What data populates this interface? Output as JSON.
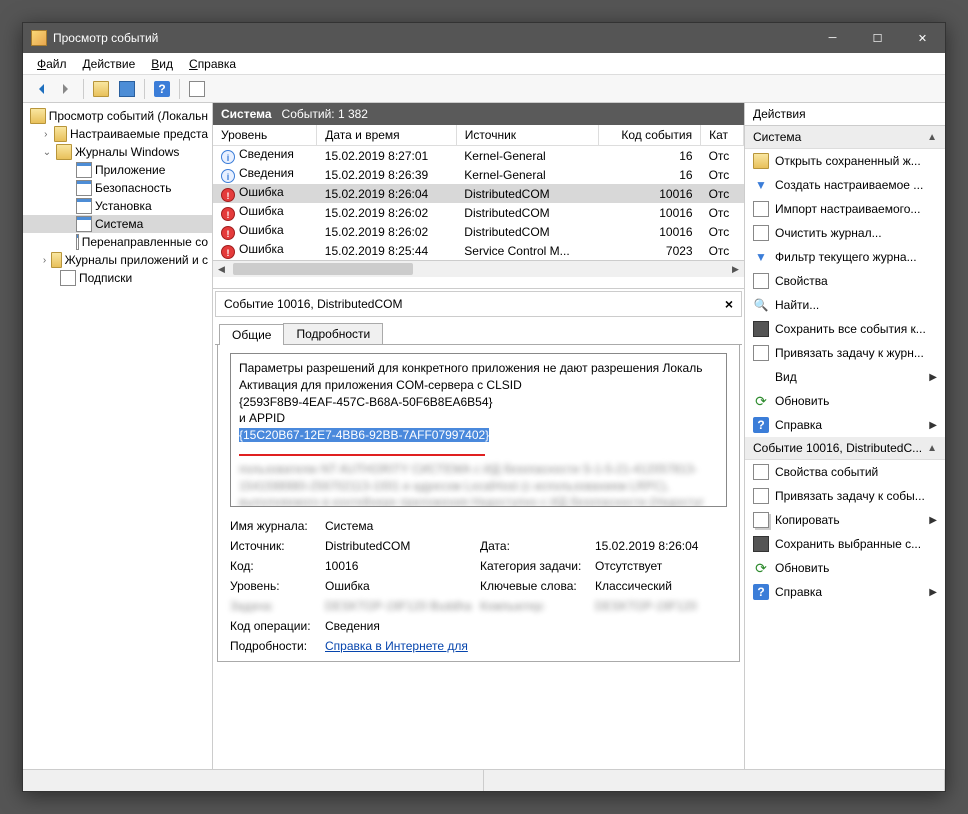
{
  "title": "Просмотр событий",
  "menus": [
    "Файл",
    "Действие",
    "Вид",
    "Справка"
  ],
  "tree": {
    "root": "Просмотр событий (Локальн",
    "custom": "Настраиваемые предста",
    "winlogs": "Журналы Windows",
    "app": "Приложение",
    "sec": "Безопасность",
    "setup": "Установка",
    "sys": "Система",
    "fwd": "Перенаправленные со",
    "appserv": "Журналы приложений и с",
    "subs": "Подписки"
  },
  "center_header": {
    "name": "Система",
    "count_label": "Событий: 1 382"
  },
  "columns": [
    "Уровень",
    "Дата и время",
    "Источник",
    "Код события",
    "Кат"
  ],
  "levels": {
    "info": "Сведения",
    "error": "Ошибка"
  },
  "rows": [
    {
      "lvl": "info",
      "date": "15.02.2019 8:27:01",
      "src": "Kernel-General",
      "code": "16",
      "cat": "Отс"
    },
    {
      "lvl": "info",
      "date": "15.02.2019 8:26:39",
      "src": "Kernel-General",
      "code": "16",
      "cat": "Отс"
    },
    {
      "lvl": "error",
      "date": "15.02.2019 8:26:04",
      "src": "DistributedCOM",
      "code": "10016",
      "cat": "Отс",
      "sel": true
    },
    {
      "lvl": "error",
      "date": "15.02.2019 8:26:02",
      "src": "DistributedCOM",
      "code": "10016",
      "cat": "Отс"
    },
    {
      "lvl": "error",
      "date": "15.02.2019 8:26:02",
      "src": "DistributedCOM",
      "code": "10016",
      "cat": "Отс"
    },
    {
      "lvl": "error",
      "date": "15.02.2019 8:25:44",
      "src": "Service Control M...",
      "code": "7023",
      "cat": "Отс"
    }
  ],
  "detail_title": "Событие 10016, DistributedCOM",
  "tabs": {
    "general": "Общие",
    "details": "Подробности"
  },
  "desc": {
    "l1": "Параметры разрешений для конкретного приложения не дают разрешения Локаль",
    "l2": "Активация для приложения COM-сервера с CLSID",
    "l3": "{2593F8B9-4EAF-457C-B68A-50F6B8EA6B54}",
    "l4": " и APPID",
    "l5": "{15C20B67-12E7-4BB6-92BB-7AFF07997402}"
  },
  "props": {
    "log_l": "Имя журнала:",
    "log_v": "Система",
    "src_l": "Источник:",
    "src_v": "DistributedCOM",
    "date_l": "Дата:",
    "date_v": "15.02.2019 8:26:04",
    "code_l": "Код:",
    "code_v": "10016",
    "cat_l": "Категория задачи:",
    "cat_v": "Отсутствует",
    "lvl_l": "Уровень:",
    "lvl_v": "Ошибка",
    "kw_l": "Ключевые слова:",
    "kw_v": "Классический",
    "op_l": "Код операции:",
    "op_v": "Сведения",
    "det_l": "Подробности:",
    "det_v": "Справка в Интернете для"
  },
  "actions_title": "Действия",
  "actions_group1": "Система",
  "actions1": [
    {
      "k": "open",
      "t": "Открыть сохраненный ж..."
    },
    {
      "k": "create",
      "t": "Создать настраиваемое ..."
    },
    {
      "k": "import",
      "t": "Импорт настраиваемого..."
    },
    {
      "k": "clear",
      "t": "Очистить журнал..."
    },
    {
      "k": "filter",
      "t": "Фильтр текущего журна..."
    },
    {
      "k": "props",
      "t": "Свойства"
    },
    {
      "k": "find",
      "t": "Найти..."
    },
    {
      "k": "saveall",
      "t": "Сохранить все события к..."
    },
    {
      "k": "bind",
      "t": "Привязать задачу к журн..."
    },
    {
      "k": "view",
      "t": "Вид",
      "arrow": true
    },
    {
      "k": "refresh",
      "t": "Обновить"
    },
    {
      "k": "help",
      "t": "Справка",
      "arrow": true
    }
  ],
  "actions_group2": "Событие 10016, DistributedC...",
  "actions2": [
    {
      "k": "evprops",
      "t": "Свойства событий"
    },
    {
      "k": "bindtask",
      "t": "Привязать задачу к собы..."
    },
    {
      "k": "copy",
      "t": "Копировать",
      "arrow": true
    },
    {
      "k": "savesel",
      "t": "Сохранить выбранные с..."
    },
    {
      "k": "refresh2",
      "t": "Обновить"
    },
    {
      "k": "help2",
      "t": "Справка",
      "arrow": true
    }
  ]
}
